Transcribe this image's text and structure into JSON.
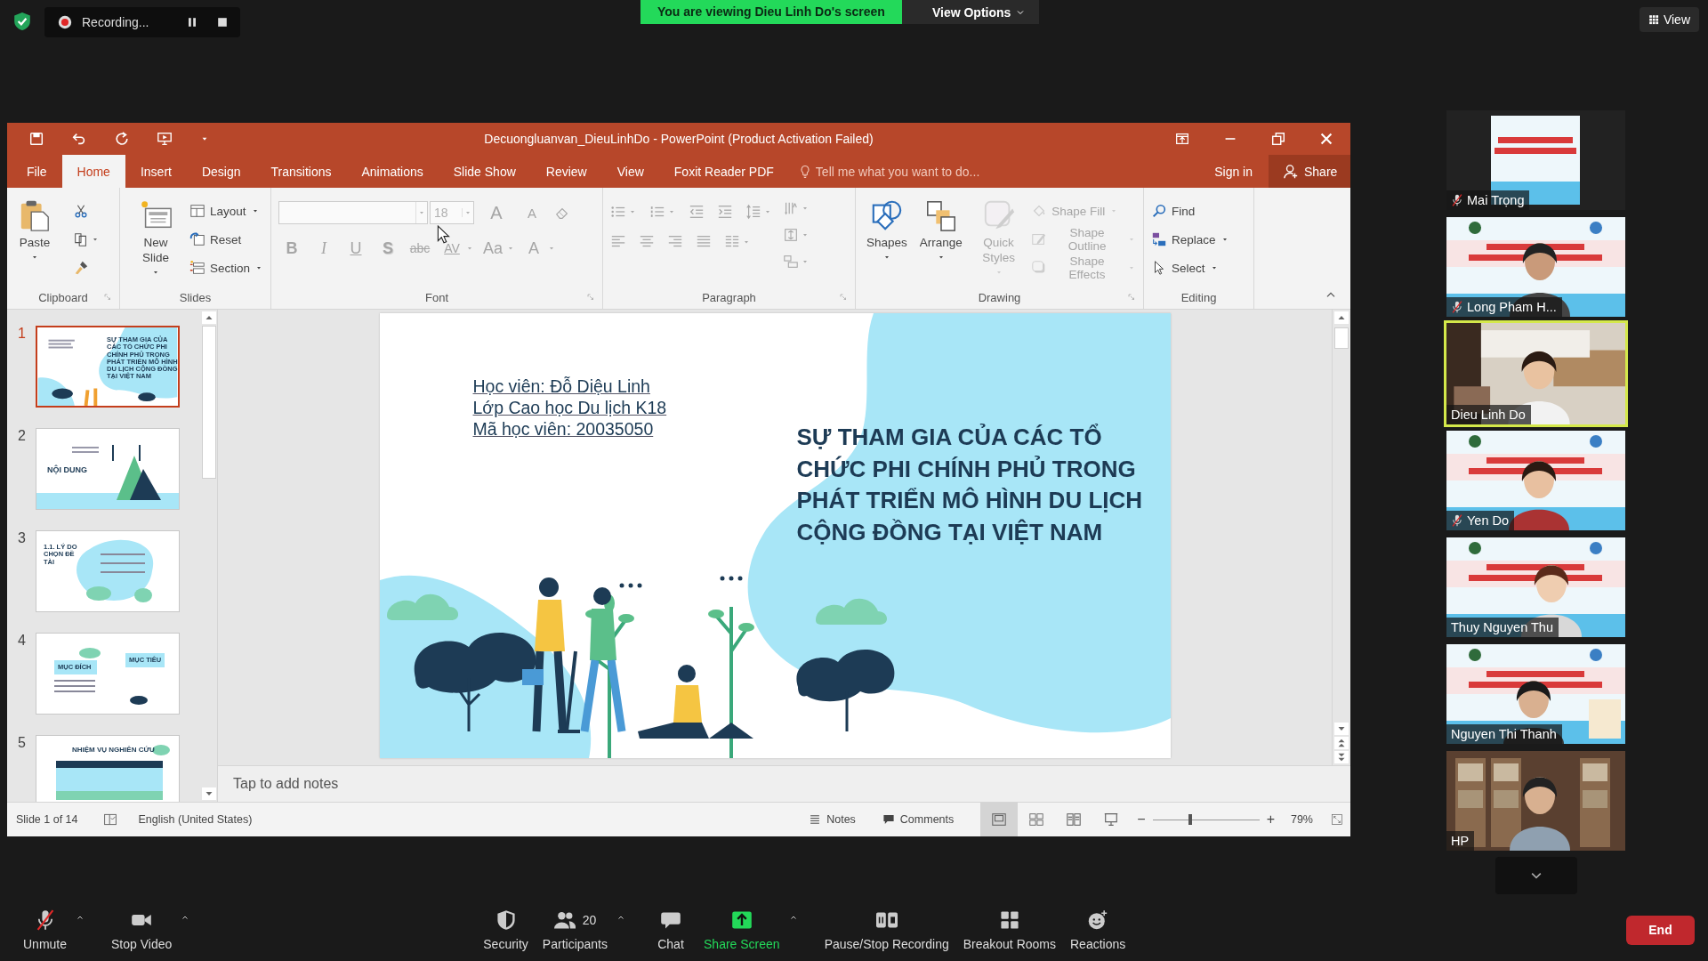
{
  "top_bar": {
    "recording": "Recording...",
    "banner": "You are viewing Dieu Linh Do's screen",
    "view_options": "View Options",
    "view": "View"
  },
  "powerpoint": {
    "title": "Decuongluanvan_DieuLinhDo - PowerPoint (Product Activation Failed)",
    "tabs": [
      {
        "label": "File",
        "selected": false
      },
      {
        "label": "Home",
        "selected": true
      },
      {
        "label": "Insert",
        "selected": false
      },
      {
        "label": "Design",
        "selected": false
      },
      {
        "label": "Transitions",
        "selected": false
      },
      {
        "label": "Animations",
        "selected": false
      },
      {
        "label": "Slide Show",
        "selected": false
      },
      {
        "label": "Review",
        "selected": false
      },
      {
        "label": "View",
        "selected": false
      },
      {
        "label": "Foxit Reader PDF",
        "selected": false
      }
    ],
    "tell_me": {
      "placeholder": "Tell me what you want to do..."
    },
    "sign_in": "Sign in",
    "share": "Share",
    "ribbon": [
      {
        "kind": "clipboard",
        "label": "Clipboard",
        "items": [
          {
            "kind": "paste",
            "label": "Paste",
            "caret": true,
            "disabled": false
          },
          {
            "kind": "cut",
            "caret": false,
            "disabled": false
          },
          {
            "kind": "copy",
            "caret": true,
            "disabled": false
          },
          {
            "kind": "painter",
            "caret": false,
            "disabled": false
          }
        ]
      },
      {
        "kind": "slides",
        "label": "Slides",
        "items": [
          {
            "kind": "newslide",
            "label": "New Slide",
            "caret": true,
            "disabled": false
          },
          {
            "kind": "layout",
            "label": "Layout",
            "caret": true,
            "disabled": false
          },
          {
            "kind": "reset",
            "label": "Reset",
            "caret": false,
            "disabled": false
          },
          {
            "kind": "section",
            "label": "Section",
            "caret": true,
            "disabled": false
          }
        ]
      },
      {
        "kind": "font",
        "label": "Font",
        "items": [
          {
            "kind": "fontname",
            "disabled": true
          },
          {
            "kind": "fontsize",
            "value": "18",
            "disabled": true
          },
          {
            "kind": "grow",
            "label": "A",
            "disabled": true
          },
          {
            "kind": "shrink",
            "label": "A",
            "disabled": true
          },
          {
            "kind": "eraser",
            "disabled": true
          },
          {
            "kind": "bold",
            "label": "B",
            "caret": false,
            "disabled": true
          },
          {
            "kind": "italic",
            "label": "I",
            "caret": false,
            "disabled": true
          },
          {
            "kind": "underline",
            "label": "U",
            "caret": false,
            "disabled": true
          },
          {
            "kind": "shadow",
            "label": "S",
            "caret": false,
            "disabled": true
          },
          {
            "kind": "strike",
            "label": "abc",
            "caret": false,
            "disabled": true
          },
          {
            "kind": "spacing",
            "label": "AV",
            "caret": true,
            "disabled": true
          },
          {
            "kind": "case",
            "label": "Aa",
            "caret": true,
            "disabled": true
          },
          {
            "kind": "color",
            "label": "A",
            "caret": true,
            "disabled": true
          }
        ]
      },
      {
        "kind": "paragraph",
        "label": "Paragraph",
        "items": [
          {
            "kind": "bullets",
            "caret": true,
            "disabled": true
          },
          {
            "kind": "numbering",
            "caret": true,
            "disabled": true
          },
          {
            "kind": "indentdec",
            "caret": false,
            "disabled": true
          },
          {
            "kind": "indentinc",
            "caret": false,
            "disabled": true
          },
          {
            "kind": "linespacing",
            "caret": true,
            "disabled": true
          },
          {
            "kind": "alignleft",
            "caret": false,
            "disabled": true
          },
          {
            "kind": "center",
            "caret": false,
            "disabled": true
          },
          {
            "kind": "alignright",
            "caret": false,
            "disabled": true
          },
          {
            "kind": "justify",
            "caret": false,
            "disabled": true
          },
          {
            "kind": "columns",
            "caret": true,
            "disabled": true
          },
          {
            "kind": "textdir",
            "caret": true,
            "disabled": true
          },
          {
            "kind": "aligntext",
            "caret": true,
            "disabled": true
          },
          {
            "kind": "smartart",
            "caret": true,
            "disabled": true
          }
        ]
      },
      {
        "kind": "drawing",
        "label": "Drawing",
        "items": [
          {
            "kind": "shapes",
            "label": "Shapes",
            "caret": true,
            "disabled": false
          },
          {
            "kind": "arrange",
            "label": "Arrange",
            "caret": true,
            "disabled": false
          },
          {
            "kind": "quickstyles",
            "label": "Quick Styles",
            "caret": true,
            "disabled": true
          },
          {
            "kind": "fill",
            "label": "Shape Fill",
            "caret": true,
            "disabled": true
          },
          {
            "kind": "outline",
            "label": "Shape Outline",
            "caret": true,
            "disabled": true
          },
          {
            "kind": "effects",
            "label": "Shape Effects",
            "caret": true,
            "disabled": true
          }
        ]
      },
      {
        "kind": "editing",
        "label": "Editing",
        "items": [
          {
            "kind": "find",
            "label": "Find",
            "caret": false,
            "disabled": false
          },
          {
            "kind": "replace",
            "label": "Replace",
            "caret": true,
            "disabled": false
          },
          {
            "kind": "select",
            "label": "Select",
            "caret": true,
            "disabled": false
          }
        ]
      }
    ],
    "thumbnails": [
      {
        "number": "1",
        "selected": true,
        "kind": "title",
        "texts": [
          "SỰ THAM GIA CỦA CÁC TỔ CHỨC PHI CHÍNH PHỦ TRONG PHÁT TRIỂN MÔ HÌNH DU LỊCH CỘNG ĐỒNG TẠI VIỆT NAM"
        ]
      },
      {
        "number": "2",
        "selected": false,
        "kind": "agenda",
        "texts": [
          "NỘI DUNG"
        ]
      },
      {
        "number": "3",
        "selected": false,
        "kind": "reasons",
        "texts": [
          "1.1. LÝ DO CHỌN ĐỀ TÀI"
        ]
      },
      {
        "number": "4",
        "selected": false,
        "kind": "goals",
        "texts": [
          "MỤC ĐÍCH",
          "MỤC TIÊU"
        ]
      },
      {
        "number": "5",
        "selected": false,
        "kind": "tasks",
        "texts": [
          "NHIỆM VỤ NGHIÊN CỨU"
        ]
      }
    ],
    "slide": {
      "info": [
        "Học viên: Đỗ Diệu Linh",
        "Lớp Cao học Du lịch K18",
        "Mã học viên: 20035050"
      ],
      "title": "SỰ THAM GIA CỦA CÁC TỔ CHỨC PHI CHÍNH PHỦ TRONG PHÁT TRIỂN MÔ HÌNH DU LỊCH CỘNG ĐỒNG TẠI VIỆT NAM"
    },
    "notes_placeholder": "Tap to add notes",
    "status_bar": {
      "slide_position": "Slide 1 of 14",
      "language": "English (United States)",
      "notes": "Notes",
      "comments": "Comments",
      "views": [
        {
          "kind": "normal",
          "selected": true
        },
        {
          "kind": "sorter",
          "selected": false
        },
        {
          "kind": "reading",
          "selected": false
        },
        {
          "kind": "show",
          "selected": false
        }
      ],
      "zoom": {
        "minus": "−",
        "plus": "+",
        "level": 0.35,
        "reading": "79%"
      }
    }
  },
  "gallery": [
    {
      "name": "Mai Trọng",
      "muted": true,
      "selected": false
    },
    {
      "name": "Long Pham H...",
      "muted": true,
      "selected": false
    },
    {
      "name": "Dieu Linh Do",
      "muted": false,
      "selected": true
    },
    {
      "name": "Yen Do",
      "muted": true,
      "selected": false
    },
    {
      "name": "Thuy Nguyen Thu",
      "muted": false,
      "selected": false
    },
    {
      "name": "Nguyen Thi Thanh",
      "muted": false,
      "selected": false
    },
    {
      "name": "HP",
      "muted": false,
      "selected": false
    }
  ],
  "toolbar": [
    {
      "kind": "mic",
      "label": "Unmute",
      "caret": true
    },
    {
      "kind": "video",
      "label": "Stop Video",
      "caret": true
    },
    {
      "kind": "security",
      "label": "Security",
      "caret": false
    },
    {
      "kind": "participants",
      "label": "Participants",
      "count": "20",
      "caret": true
    },
    {
      "kind": "chat",
      "label": "Chat",
      "caret": false
    },
    {
      "kind": "share",
      "label": "Share Screen",
      "caret": true
    },
    {
      "kind": "record",
      "label": "Pause/Stop Recording",
      "caret": false
    },
    {
      "kind": "breakout",
      "label": "Breakout Rooms",
      "caret": false
    },
    {
      "kind": "reactions",
      "label": "Reactions",
      "caret": false
    }
  ],
  "end_button": "End"
}
